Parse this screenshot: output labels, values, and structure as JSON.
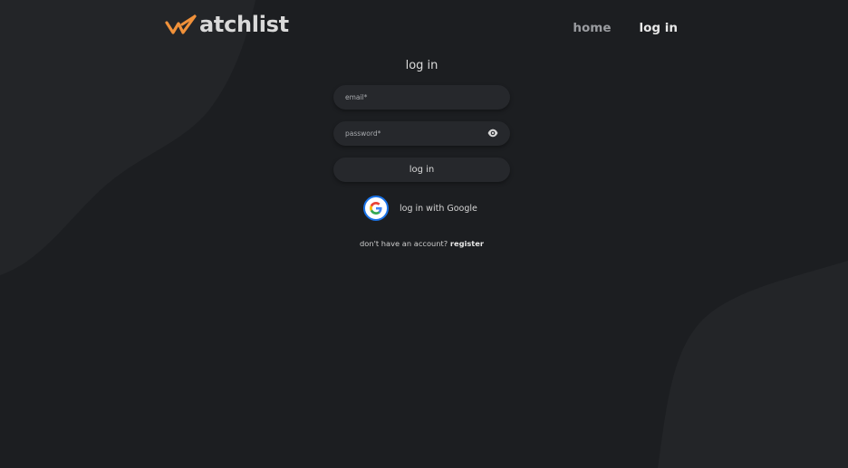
{
  "colors": {
    "background": "#1c1e21",
    "blob": "#232528",
    "field": "#26282c",
    "brand_orange": "#f0913a",
    "google_ring": "#1a73e8"
  },
  "header": {
    "logo_icon": "double-check-w-icon",
    "logo_text": "atchlist",
    "nav": {
      "home": "home",
      "login": "log in"
    }
  },
  "form": {
    "title": "log in",
    "email_placeholder": "email*",
    "password_placeholder": "password*",
    "password_toggle_icon": "eye-icon",
    "submit_label": "log in"
  },
  "google": {
    "icon": "google-g-icon",
    "label": "log in with Google"
  },
  "register": {
    "prompt": "don't have an account?",
    "link": "register"
  }
}
